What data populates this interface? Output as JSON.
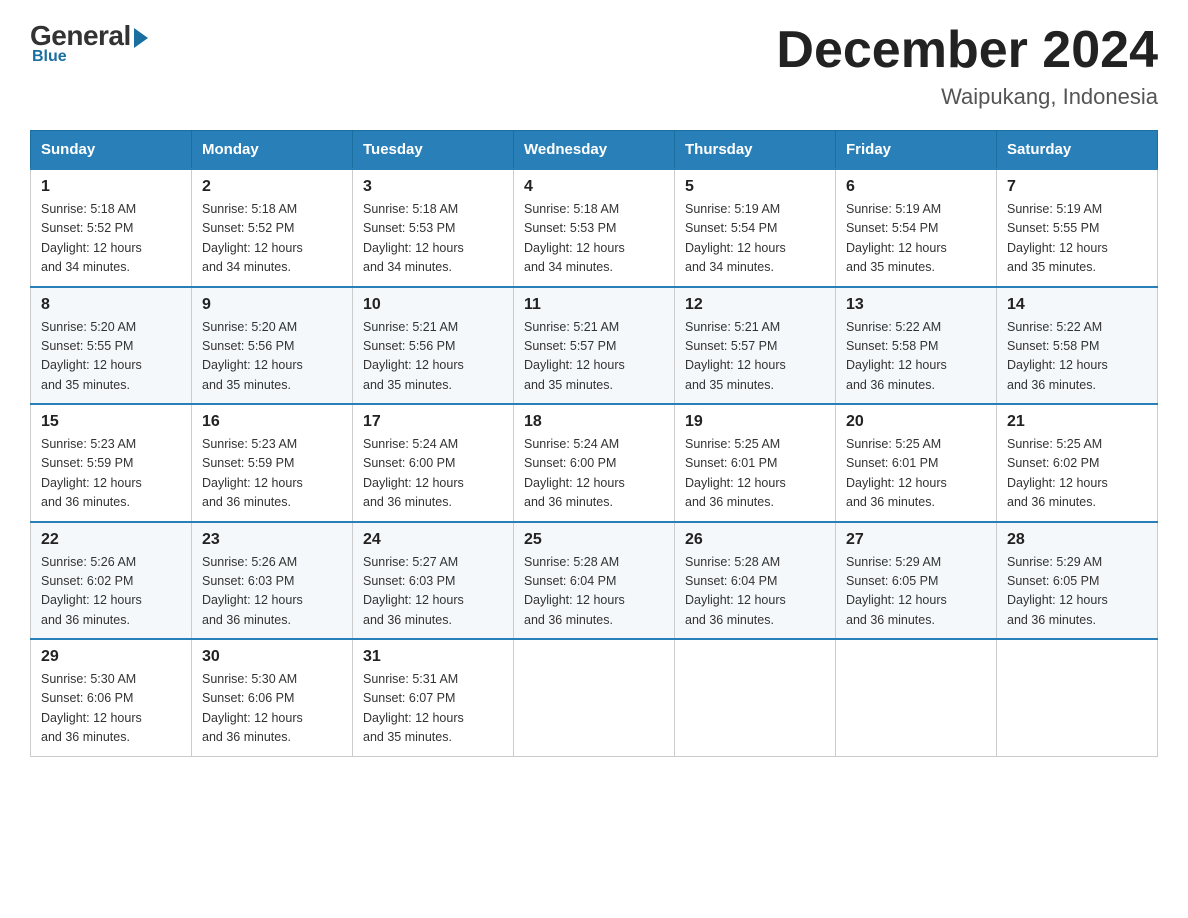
{
  "logo": {
    "general": "General",
    "blue": "Blue"
  },
  "title": "December 2024",
  "location": "Waipukang, Indonesia",
  "days_of_week": [
    "Sunday",
    "Monday",
    "Tuesday",
    "Wednesday",
    "Thursday",
    "Friday",
    "Saturday"
  ],
  "weeks": [
    [
      {
        "day": "1",
        "sunrise": "5:18 AM",
        "sunset": "5:52 PM",
        "daylight": "12 hours and 34 minutes."
      },
      {
        "day": "2",
        "sunrise": "5:18 AM",
        "sunset": "5:52 PM",
        "daylight": "12 hours and 34 minutes."
      },
      {
        "day": "3",
        "sunrise": "5:18 AM",
        "sunset": "5:53 PM",
        "daylight": "12 hours and 34 minutes."
      },
      {
        "day": "4",
        "sunrise": "5:18 AM",
        "sunset": "5:53 PM",
        "daylight": "12 hours and 34 minutes."
      },
      {
        "day": "5",
        "sunrise": "5:19 AM",
        "sunset": "5:54 PM",
        "daylight": "12 hours and 34 minutes."
      },
      {
        "day": "6",
        "sunrise": "5:19 AM",
        "sunset": "5:54 PM",
        "daylight": "12 hours and 35 minutes."
      },
      {
        "day": "7",
        "sunrise": "5:19 AM",
        "sunset": "5:55 PM",
        "daylight": "12 hours and 35 minutes."
      }
    ],
    [
      {
        "day": "8",
        "sunrise": "5:20 AM",
        "sunset": "5:55 PM",
        "daylight": "12 hours and 35 minutes."
      },
      {
        "day": "9",
        "sunrise": "5:20 AM",
        "sunset": "5:56 PM",
        "daylight": "12 hours and 35 minutes."
      },
      {
        "day": "10",
        "sunrise": "5:21 AM",
        "sunset": "5:56 PM",
        "daylight": "12 hours and 35 minutes."
      },
      {
        "day": "11",
        "sunrise": "5:21 AM",
        "sunset": "5:57 PM",
        "daylight": "12 hours and 35 minutes."
      },
      {
        "day": "12",
        "sunrise": "5:21 AM",
        "sunset": "5:57 PM",
        "daylight": "12 hours and 35 minutes."
      },
      {
        "day": "13",
        "sunrise": "5:22 AM",
        "sunset": "5:58 PM",
        "daylight": "12 hours and 36 minutes."
      },
      {
        "day": "14",
        "sunrise": "5:22 AM",
        "sunset": "5:58 PM",
        "daylight": "12 hours and 36 minutes."
      }
    ],
    [
      {
        "day": "15",
        "sunrise": "5:23 AM",
        "sunset": "5:59 PM",
        "daylight": "12 hours and 36 minutes."
      },
      {
        "day": "16",
        "sunrise": "5:23 AM",
        "sunset": "5:59 PM",
        "daylight": "12 hours and 36 minutes."
      },
      {
        "day": "17",
        "sunrise": "5:24 AM",
        "sunset": "6:00 PM",
        "daylight": "12 hours and 36 minutes."
      },
      {
        "day": "18",
        "sunrise": "5:24 AM",
        "sunset": "6:00 PM",
        "daylight": "12 hours and 36 minutes."
      },
      {
        "day": "19",
        "sunrise": "5:25 AM",
        "sunset": "6:01 PM",
        "daylight": "12 hours and 36 minutes."
      },
      {
        "day": "20",
        "sunrise": "5:25 AM",
        "sunset": "6:01 PM",
        "daylight": "12 hours and 36 minutes."
      },
      {
        "day": "21",
        "sunrise": "5:25 AM",
        "sunset": "6:02 PM",
        "daylight": "12 hours and 36 minutes."
      }
    ],
    [
      {
        "day": "22",
        "sunrise": "5:26 AM",
        "sunset": "6:02 PM",
        "daylight": "12 hours and 36 minutes."
      },
      {
        "day": "23",
        "sunrise": "5:26 AM",
        "sunset": "6:03 PM",
        "daylight": "12 hours and 36 minutes."
      },
      {
        "day": "24",
        "sunrise": "5:27 AM",
        "sunset": "6:03 PM",
        "daylight": "12 hours and 36 minutes."
      },
      {
        "day": "25",
        "sunrise": "5:28 AM",
        "sunset": "6:04 PM",
        "daylight": "12 hours and 36 minutes."
      },
      {
        "day": "26",
        "sunrise": "5:28 AM",
        "sunset": "6:04 PM",
        "daylight": "12 hours and 36 minutes."
      },
      {
        "day": "27",
        "sunrise": "5:29 AM",
        "sunset": "6:05 PM",
        "daylight": "12 hours and 36 minutes."
      },
      {
        "day": "28",
        "sunrise": "5:29 AM",
        "sunset": "6:05 PM",
        "daylight": "12 hours and 36 minutes."
      }
    ],
    [
      {
        "day": "29",
        "sunrise": "5:30 AM",
        "sunset": "6:06 PM",
        "daylight": "12 hours and 36 minutes."
      },
      {
        "day": "30",
        "sunrise": "5:30 AM",
        "sunset": "6:06 PM",
        "daylight": "12 hours and 36 minutes."
      },
      {
        "day": "31",
        "sunrise": "5:31 AM",
        "sunset": "6:07 PM",
        "daylight": "12 hours and 35 minutes."
      },
      null,
      null,
      null,
      null
    ]
  ]
}
